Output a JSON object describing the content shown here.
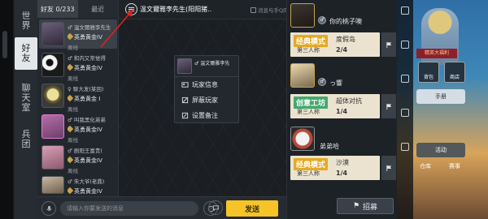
{
  "vertical_tabs": [
    {
      "label": "世界",
      "active": false
    },
    {
      "label": "好友",
      "active": true
    },
    {
      "label": "聊天室",
      "active": false
    },
    {
      "label": "兵团",
      "active": false
    }
  ],
  "list_tabs": [
    {
      "label": "好友 0/233",
      "active": true
    },
    {
      "label": "最近",
      "active": false
    }
  ],
  "friends": [
    {
      "name": "♂ 温文爾雅李先生",
      "rank": "英勇黄金IV",
      "status": "离线",
      "selected": true
    },
    {
      "name": "♂ 和内又常觉得",
      "rank": "英勇黄金IV",
      "status": "离线",
      "selected": false
    },
    {
      "name": "♀ 聊大发(某回)",
      "rank": "英勇黄金 I",
      "status": "离线",
      "selected": false
    },
    {
      "name": "♂ 叫我黑化弟弟",
      "rank": "英勇黄金IV",
      "status": "离线",
      "selected": false
    },
    {
      "name": "♂ 剧阳王富贵(",
      "rank": "英勇黄金IV",
      "status": "离线",
      "selected": false
    },
    {
      "name": "♂ 朱大爷(老鼎)",
      "rank": "英勇黄金IV",
      "status": "离线",
      "selected": false
    }
  ],
  "chat": {
    "title": "温文爾雅李先生(阳阳猪..",
    "sync_label": "消息与手Q同步"
  },
  "context_menu": {
    "name": "♂ 温文爾雅李先",
    "items": [
      {
        "label": "玩家信息",
        "icon": "id-card-icon"
      },
      {
        "label": "屏蔽玩家",
        "icon": "block-icon"
      },
      {
        "label": "设置备注",
        "icon": "edit-icon"
      }
    ]
  },
  "input": {
    "placeholder": "请输入你要发送的消息",
    "send_label": "发送"
  },
  "recruit": {
    "button_label": "招募",
    "entries": [
      {
        "name": "你的桃子噢",
        "mode": "经典模式",
        "mode_color": "#e4a924",
        "perspective": "第三人称",
        "map": "度假岛",
        "count": "2/4"
      },
      {
        "name": "っ響",
        "mode": "创意工坊",
        "mode_color": "#43a86d",
        "perspective": "第三人称",
        "map": "超体对抗",
        "count": "1/4"
      },
      {
        "name": "弟弟哈",
        "mode": "经典模式",
        "mode_color": "#e4a924",
        "perspective": "第三人称",
        "map": "沙漠",
        "count": "1/4"
      }
    ]
  },
  "game_panel": {
    "banner": "精英大福利",
    "b1": "背包",
    "b2": "商店",
    "label_1": "手册",
    "label_2": "活动",
    "label_3": "仓库",
    "label_4": "赛事",
    "accent": "#f5c427"
  }
}
